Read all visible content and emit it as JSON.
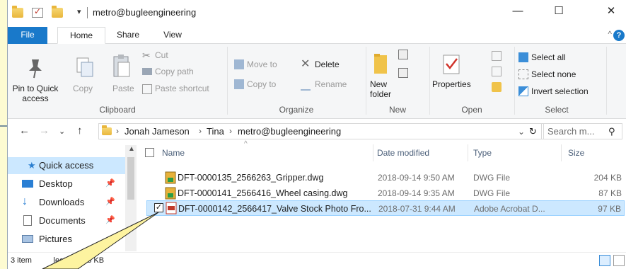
{
  "window": {
    "title": "metro@bugleengineering",
    "qat_arrow": "▾",
    "minimize": "—",
    "maximize": "☐",
    "close": "✕"
  },
  "tabs": [
    "File",
    "Home",
    "Share",
    "View"
  ],
  "ribbon": {
    "clipboard": {
      "pin": "Pin to Quick access",
      "copy": "Copy",
      "paste": "Paste",
      "cut": "Cut",
      "copy_path": "Copy path",
      "paste_shortcut": "Paste shortcut",
      "label": "Clipboard"
    },
    "organize": {
      "move_to": "Move to",
      "delete": "Delete",
      "copy_to": "Copy to",
      "rename": "Rename",
      "label": "Organize"
    },
    "new": {
      "new_folder": "New folder",
      "label": "New"
    },
    "open": {
      "properties": "Properties",
      "label": "Open"
    },
    "select": {
      "select_all": "Select all",
      "select_none": "Select none",
      "invert": "Invert selection",
      "label": "Select"
    }
  },
  "address": {
    "crumbs": [
      "Jonah Jameson",
      "Tina",
      "metro@bugleengineering"
    ],
    "separator": "›",
    "search_placeholder": "Search m..."
  },
  "nav_pane": {
    "items": [
      {
        "label": "Quick access",
        "icon": "star-icon",
        "selected": true
      },
      {
        "label": "Desktop",
        "icon": "desktop-icon"
      },
      {
        "label": "Downloads",
        "icon": "download-icon"
      },
      {
        "label": "Documents",
        "icon": "document-icon"
      },
      {
        "label": "Pictures",
        "icon": "pictures-icon"
      }
    ]
  },
  "columns": {
    "name": "Name",
    "date": "Date modified",
    "type": "Type",
    "size": "Size"
  },
  "files": [
    {
      "name": "DFT-0000135_2566263_Gripper.dwg",
      "date": "2018-09-14 9:50 AM",
      "type": "DWG File",
      "size": "204 KB",
      "icon": "dwg-file-icon",
      "selected": false
    },
    {
      "name": "DFT-0000141_2566416_Wheel casing.dwg",
      "date": "2018-09-14 9:35 AM",
      "type": "DWG File",
      "size": "87 KB",
      "icon": "dwg-file-icon",
      "selected": false
    },
    {
      "name": "DFT-0000142_2566417_Valve Stock Photo Fro...",
      "date": "2018-07-31 9:44 AM",
      "type": "Adobe Acrobat D...",
      "size": "97 KB",
      "icon": "pdf-file-icon",
      "selected": true
    }
  ],
  "status": {
    "text": "3 item          lected 96.8 KB"
  },
  "colors": {
    "accent": "#1979ca",
    "selection": "#cce8ff",
    "callout": "#fdf3a0"
  }
}
